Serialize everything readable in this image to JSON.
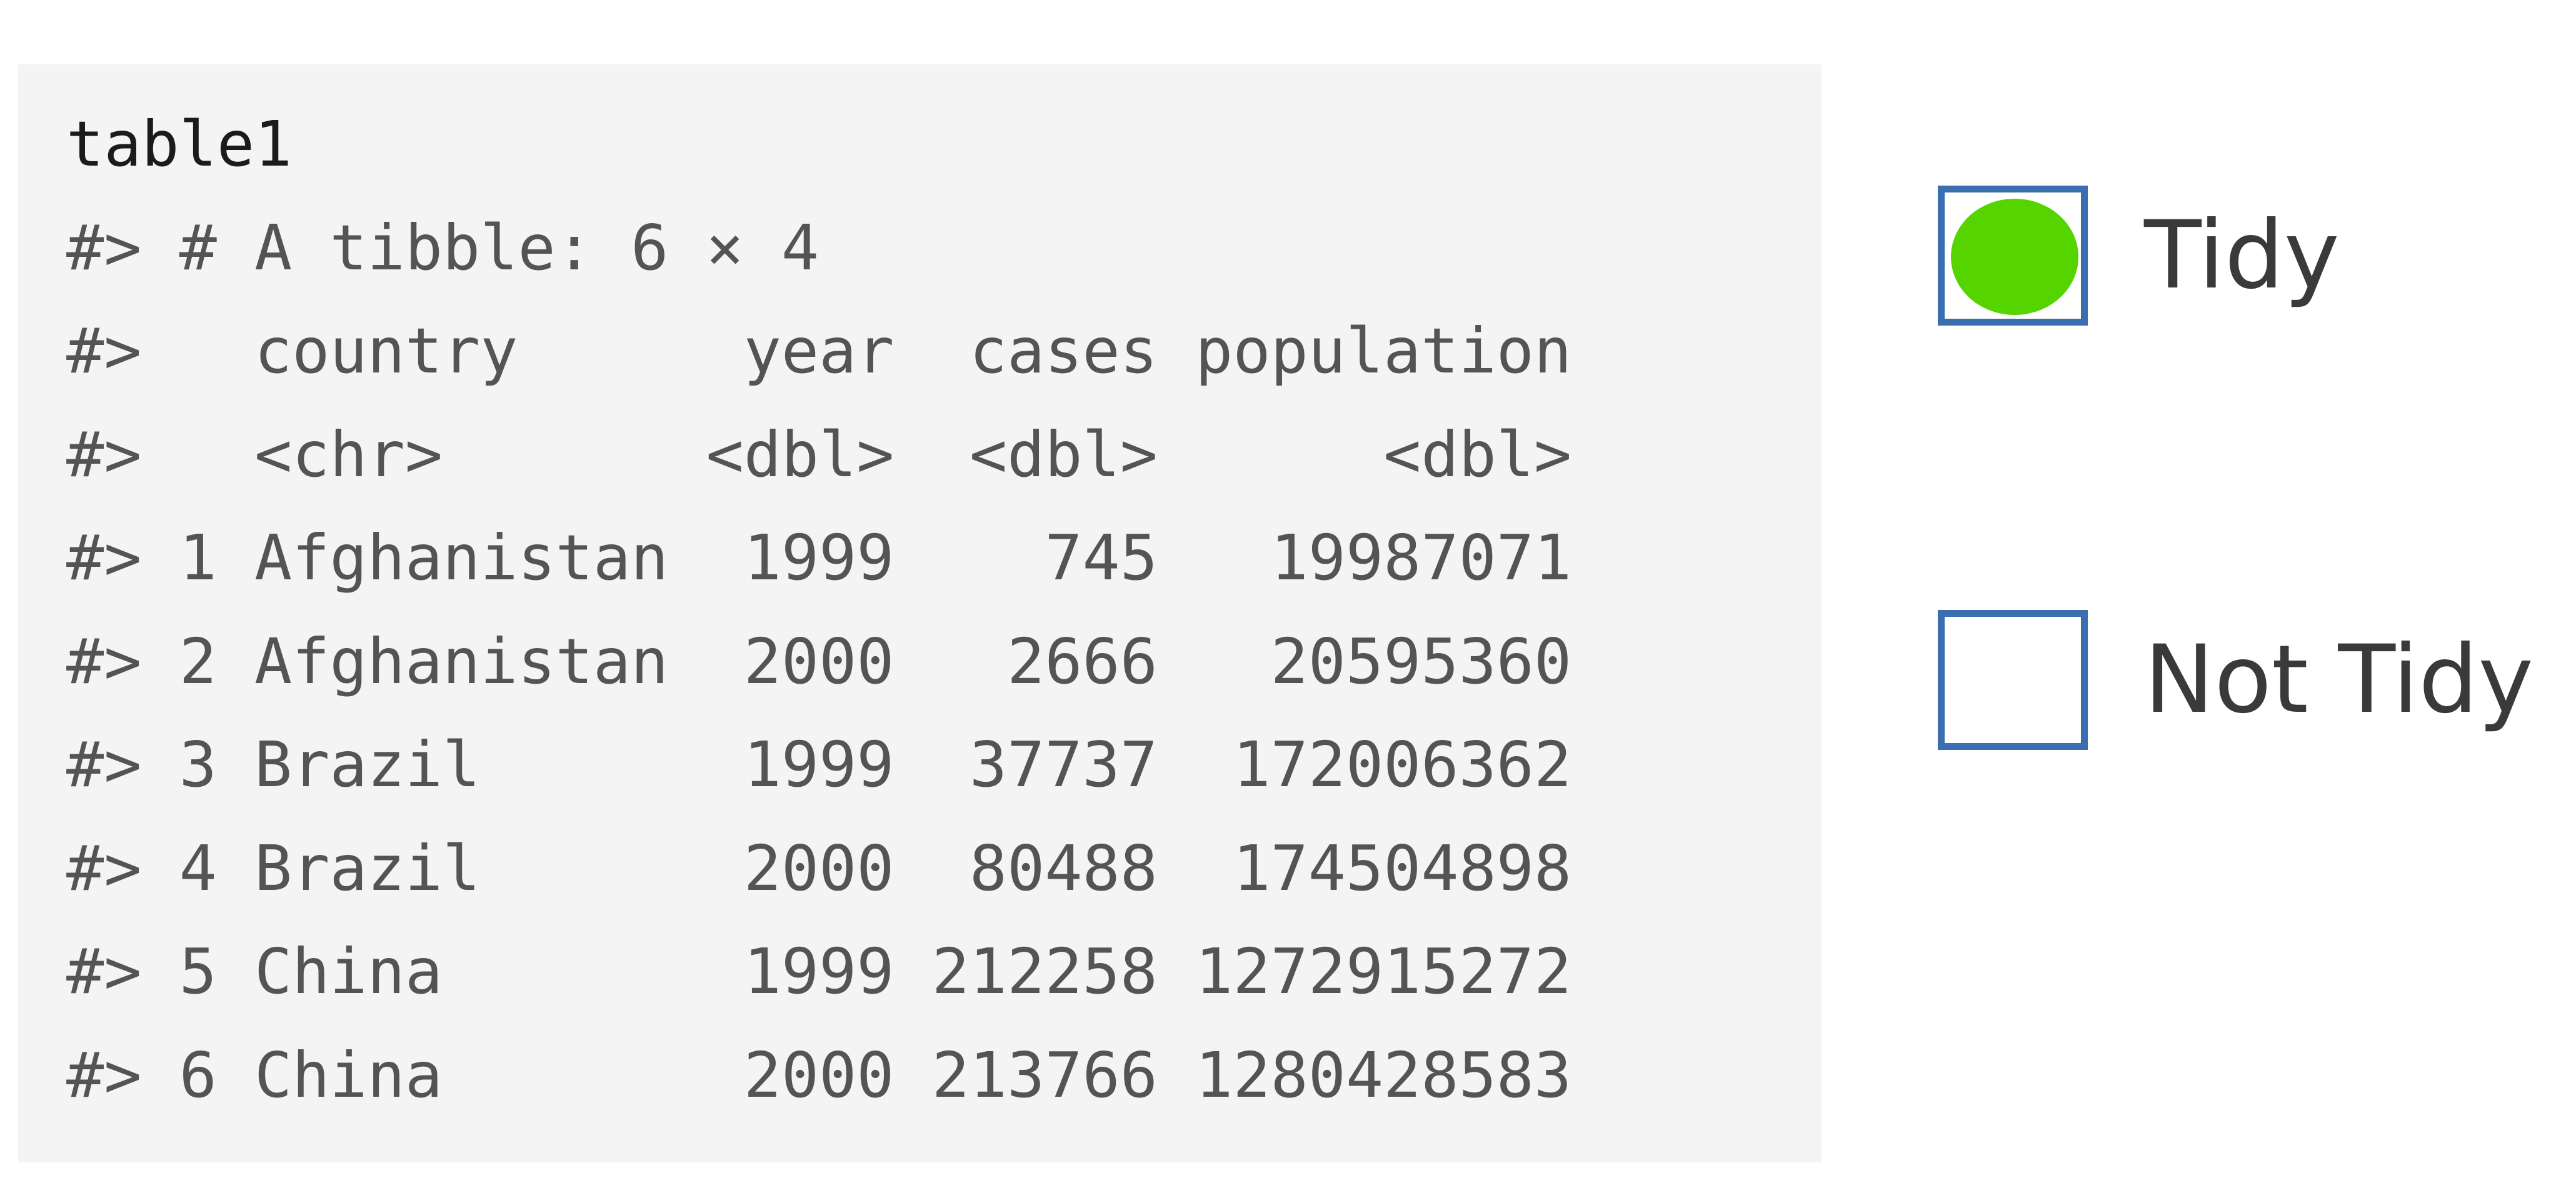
{
  "code": {
    "lines": [
      "table1",
      "#> # A tibble: 6 × 4",
      "#>   country      year  cases population",
      "#>   <chr>       <dbl>  <dbl>      <dbl>",
      "#> 1 Afghanistan  1999    745   19987071",
      "#> 2 Afghanistan  2000   2666   20595360",
      "#> 3 Brazil       1999  37737  172006362",
      "#> 4 Brazil       2000  80488  174504898",
      "#> 5 China        1999 212258 1272915272",
      "#> 6 China        2000 213766 1280428583"
    ]
  },
  "options": [
    {
      "label": "Tidy",
      "selected": true
    },
    {
      "label": "Not Tidy",
      "selected": false
    }
  ],
  "colors": {
    "checkbox_border": "#3a6eb0",
    "selected_fill": "#56d400",
    "panel_background": "#f4f4f4"
  }
}
